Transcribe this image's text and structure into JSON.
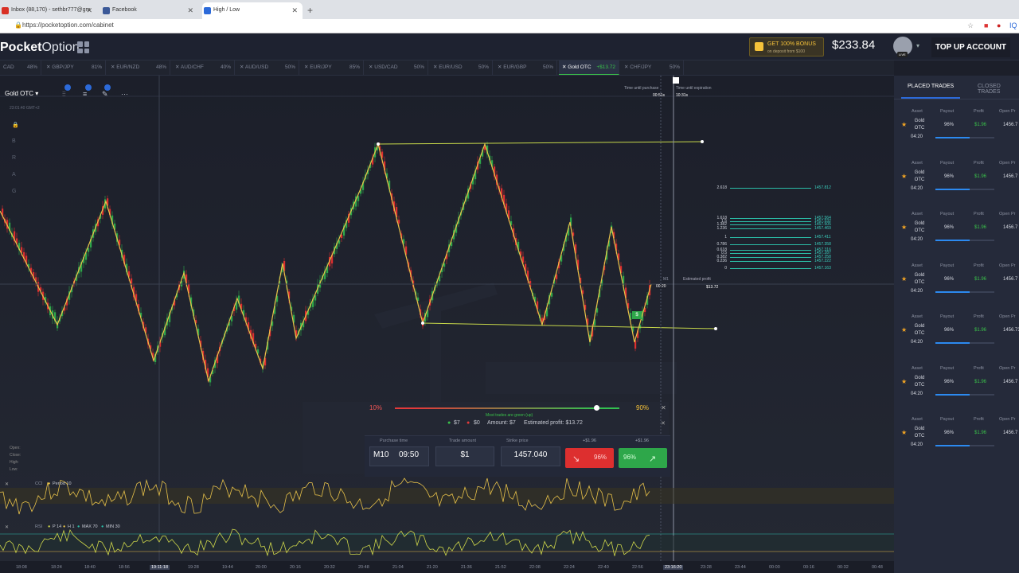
{
  "browser": {
    "tabs": [
      {
        "title": "Inbox (88,170) - sethbr777@gm",
        "icon": "gmail-icon",
        "color": "#d93025"
      },
      {
        "title": "Facebook",
        "icon": "facebook-icon",
        "color": "#3b5998"
      },
      {
        "title": "High / Low",
        "icon": "pocketoption-icon",
        "color": "#2c6ad9"
      }
    ],
    "url": "https://pocketoption.com/cabinet"
  },
  "header": {
    "logo_bold": "Pocket",
    "logo_thin": "Option",
    "bonus_title": "GET 100% BONUS",
    "bonus_sub": "on deposit from $100",
    "balance": "$233.84",
    "live_badge": "LIVE",
    "topup": "TOP UP ACCOUNT"
  },
  "asset_tabs": [
    {
      "name": "CAD",
      "payout": "48%"
    },
    {
      "name": "GBP/JPY",
      "payout": "81%"
    },
    {
      "name": "EUR/NZD",
      "payout": "48%"
    },
    {
      "name": "AUD/CHF",
      "payout": "40%"
    },
    {
      "name": "AUD/USD",
      "payout": "50%"
    },
    {
      "name": "EUR/JPY",
      "payout": "85%"
    },
    {
      "name": "USD/CAD",
      "payout": "50%"
    },
    {
      "name": "EUR/USD",
      "payout": "50%"
    },
    {
      "name": "EUR/GBP",
      "payout": "50%"
    },
    {
      "name": "Gold OTC",
      "payout": "+$13.72"
    },
    {
      "name": "CHF/JPY",
      "payout": "50%"
    }
  ],
  "chart": {
    "asset": "Gold OTC",
    "timezone": "23:01:40 GMT+2",
    "side_letters": [
      "B",
      "R",
      "A",
      "G"
    ],
    "ohlc": [
      "Open:",
      "Close:",
      "High:",
      "Low:"
    ],
    "time_until_purchase": "Time until purchase",
    "purchase_value": "00:51s",
    "time_until_expiration": "Time until expiration",
    "expiration_value": "10:31s",
    "m1": "M1",
    "price_time": "00:20",
    "estimated_profit_label": "Estimated profit",
    "estimated_profit": "$13.72",
    "trade_marker": "$",
    "fib_levels": [
      {
        "ratio": "2.618",
        "price": "1457.812"
      },
      {
        "ratio": "1.618",
        "price": "1457.564"
      },
      {
        "ratio": "1.5",
        "price": "1457.532"
      },
      {
        "ratio": "1.382",
        "price": "1457.505"
      },
      {
        "ratio": "1.236",
        "price": "1457.469"
      },
      {
        "ratio": "1",
        "price": "1457.411"
      },
      {
        "ratio": "0.786",
        "price": "1457.358"
      },
      {
        "ratio": "0.618",
        "price": "1457.316"
      },
      {
        "ratio": "0.5",
        "price": "1457.287"
      },
      {
        "ratio": "0.382",
        "price": "1457.258"
      },
      {
        "ratio": "0.236",
        "price": "1457.222"
      },
      {
        "ratio": "0",
        "price": "1457.163"
      }
    ]
  },
  "sentiment": {
    "low": "10%",
    "high": "90%",
    "caption": "Most trades are green (up)",
    "up_fraction": 0.9
  },
  "trade_info": {
    "up_amount": "$7",
    "down_amount": "$0",
    "amount": "Amount: $7",
    "estimated": "Estimated profit: $13.72"
  },
  "trade_panel": {
    "purchase_time_label": "Purchase time",
    "timeframe": "M10",
    "time": "09:50",
    "trade_amount_label": "Trade amount",
    "amount": "$1",
    "strike_label": "Strike price",
    "strike": "1457.040",
    "down_payout": "96%",
    "up_payout": "96%",
    "down_profit": "+$1.96",
    "up_profit": "+$1.96",
    "minus": "-",
    "plus": "+"
  },
  "indicators": [
    {
      "name": "CCI",
      "tags": [
        "Period 10"
      ]
    },
    {
      "name": "RSI",
      "tags": [
        "P 14",
        "H 1",
        "MAX 70",
        "MIN 30"
      ]
    }
  ],
  "time_axis": [
    "18:08",
    "18:24",
    "18:40",
    "18:56",
    "19:11:18",
    "19:28",
    "19:44",
    "20:00",
    "20:16",
    "20:32",
    "20:48",
    "21:04",
    "21:20",
    "21:36",
    "21:52",
    "22:08",
    "22:24",
    "22:40",
    "22:56",
    "23:16:20",
    "23:28",
    "23:44",
    "00:00",
    "00:16",
    "00:32",
    "00:48"
  ],
  "right_panel": {
    "tab_placed": "PLACED TRADES",
    "tab_closed": "CLOSED TRADES",
    "headers": [
      "Asset",
      "Payout",
      "Profit",
      "Open Pr"
    ],
    "trades": [
      {
        "asset": "Gold OTC",
        "duration": "04:20",
        "payout": "96%",
        "profit": "$1.96",
        "open": "1456.7",
        "progress": 0.58
      },
      {
        "asset": "Gold OTC",
        "duration": "04:20",
        "payout": "96%",
        "profit": "$1.96",
        "open": "1456.7",
        "progress": 0.58
      },
      {
        "asset": "Gold OTC",
        "duration": "04:20",
        "payout": "96%",
        "profit": "$1.96",
        "open": "1456.7",
        "progress": 0.58
      },
      {
        "asset": "Gold OTC",
        "duration": "04:20",
        "payout": "96%",
        "profit": "$1.96",
        "open": "1456.7",
        "progress": 0.58
      },
      {
        "asset": "Gold OTC",
        "duration": "04:20",
        "payout": "96%",
        "profit": "$1.96",
        "open": "1456.73",
        "progress": 0.58
      },
      {
        "asset": "Gold OTC",
        "duration": "04:20",
        "payout": "96%",
        "profit": "$1.96",
        "open": "1456.7",
        "progress": 0.58
      },
      {
        "asset": "Gold OTC",
        "duration": "04:20",
        "payout": "96%",
        "profit": "$1.96",
        "open": "1456.7",
        "progress": 0.58
      }
    ]
  },
  "colors": {
    "up": "#2ea74a",
    "down": "#dd2f2f",
    "zigzag": "#e8c24a",
    "accent": "#2c6ad9"
  }
}
